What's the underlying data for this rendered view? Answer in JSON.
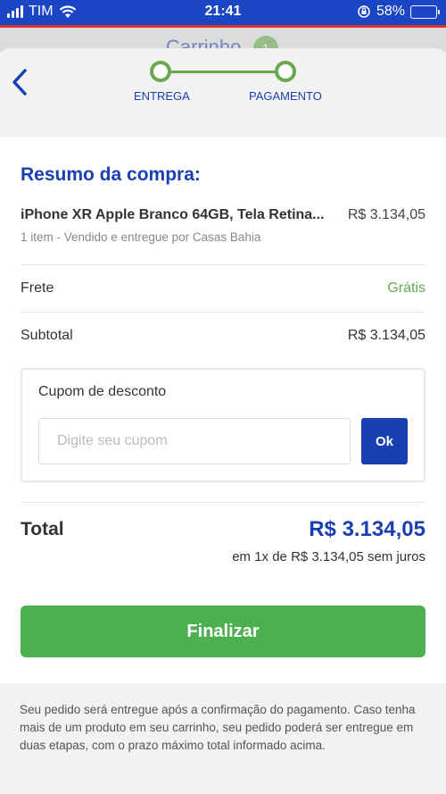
{
  "status_bar": {
    "carrier": "TIM",
    "time": "21:41",
    "battery": "58%"
  },
  "background": {
    "title": "Carrinho",
    "badge": "1"
  },
  "stepper": {
    "steps": [
      {
        "label": "ENTREGA"
      },
      {
        "label": "PAGAMENTO"
      }
    ]
  },
  "summary": {
    "title": "Resumo da compra:",
    "product": {
      "name": "iPhone XR Apple Branco 64GB, Tela Retina...",
      "price": "R$ 3.134,05",
      "sub": "1 item - Vendido e entregue por Casas Bahia"
    },
    "shipping": {
      "label": "Frete",
      "value": "Grátis"
    },
    "subtotal": {
      "label": "Subtotal",
      "value": "R$ 3.134,05"
    }
  },
  "coupon": {
    "title": "Cupom de desconto",
    "placeholder": "Digite seu cupom",
    "value": "",
    "button": "Ok"
  },
  "total": {
    "label": "Total",
    "value": "R$ 3.134,05",
    "installments": "em 1x de R$ 3.134,05 sem juros"
  },
  "finalize_button": "Finalizar",
  "footer_note": "Seu pedido será entregue após a confirmação do pagamento. Caso tenha mais de um produto em seu carrinho, seu pedido poderá ser entregue em duas etapas, com o prazo máximo total informado acima.",
  "colors": {
    "primary": "#1a3fb0",
    "success": "#4caf50",
    "step": "#6aa84f"
  }
}
